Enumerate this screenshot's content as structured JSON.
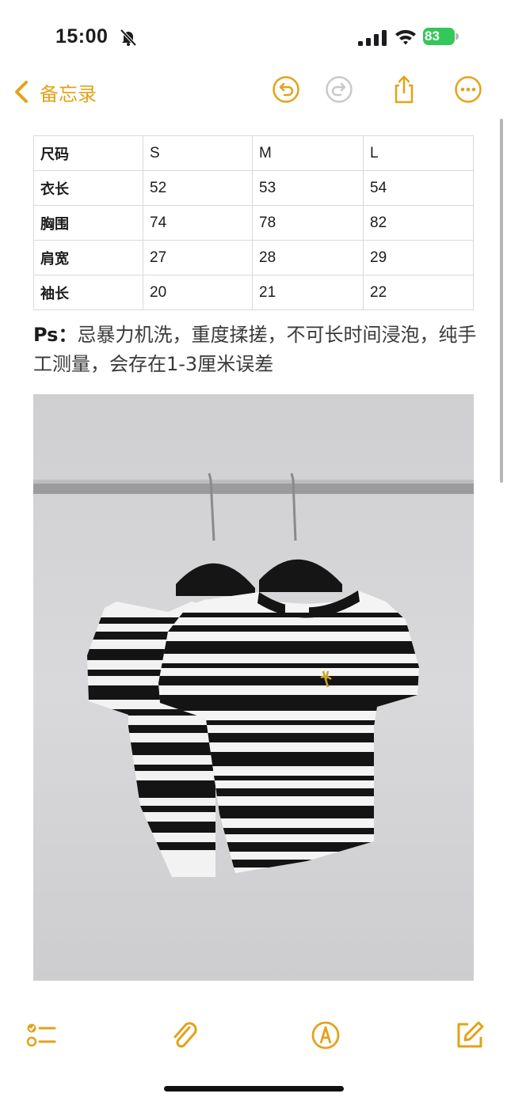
{
  "status": {
    "time": "15:00",
    "battery": "83"
  },
  "nav": {
    "back_label": "备忘录"
  },
  "table": {
    "rows": [
      [
        "尺码",
        "S",
        "M",
        "L"
      ],
      [
        "衣长",
        "52",
        "53",
        "54"
      ],
      [
        "胸围",
        "74",
        "78",
        "82"
      ],
      [
        "肩宽",
        "27",
        "28",
        "29"
      ],
      [
        "袖长",
        "20",
        "21",
        "22"
      ]
    ]
  },
  "note": {
    "ps": "Ps：",
    "text": "忌暴力机洗，重度揉搓，不可长时间浸泡，纯手工测量，会存在1-3厘米误差"
  },
  "colors": {
    "accent": "#e3a21a",
    "battery": "#34c759"
  },
  "icons": [
    "bell-slash-icon",
    "signal-icon",
    "wifi-icon",
    "battery-icon",
    "chevron-left-icon",
    "undo-icon",
    "redo-icon",
    "share-icon",
    "more-icon",
    "checklist-icon",
    "paperclip-icon",
    "markup-pen-icon",
    "compose-icon"
  ]
}
